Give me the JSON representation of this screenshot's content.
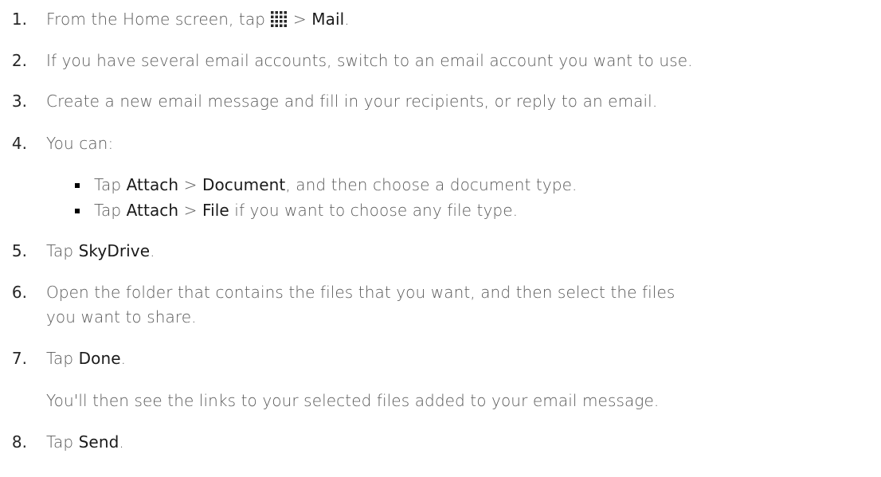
{
  "steps": [
    {
      "num": "1.",
      "before": "From the Home screen, tap ",
      "icon": "apps-grid-icon",
      "mid": " > ",
      "b1": "Mail",
      "after": "."
    },
    {
      "num": "2.",
      "text": "If you have several email accounts, switch to an email account you want to use."
    },
    {
      "num": "3.",
      "text": "Create a new email message and fill in your recipients, or reply to an email."
    },
    {
      "num": "4.",
      "text": "You can:"
    },
    {
      "num": "5.",
      "before": "Tap ",
      "b1": "SkyDrive",
      "after": "."
    },
    {
      "num": "6.",
      "line1": "Open the folder that contains the files that you want, and then select the files",
      "line2": "you want to share."
    },
    {
      "num": "7.",
      "before": "Tap ",
      "b1": "Done",
      "after": ".",
      "note": "You'll then see the links to your selected files added to your email message."
    },
    {
      "num": "8.",
      "before": "Tap ",
      "b1": "Send",
      "after": "."
    }
  ],
  "bullets": [
    {
      "before": "Tap ",
      "b1": "Attach",
      "mid": " > ",
      "b2": "Document",
      "after": ", and then choose a document type."
    },
    {
      "before": "Tap ",
      "b1": "Attach",
      "mid": " > ",
      "b2": "File",
      "after": " if you want to choose any file type."
    }
  ]
}
